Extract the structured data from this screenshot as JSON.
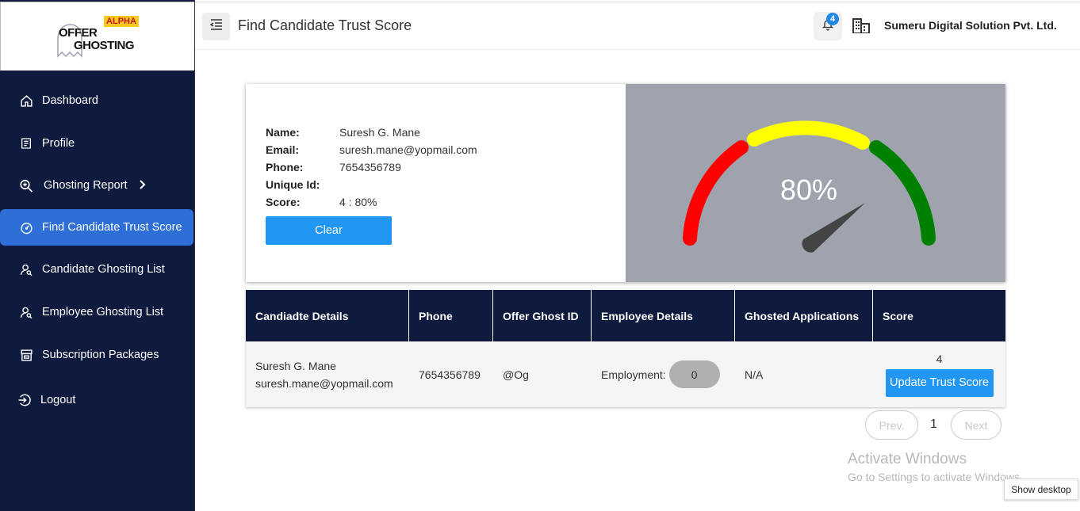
{
  "logo": {
    "badge": "ALPHA",
    "line1": "OFFER",
    "line2": "GHOSTING"
  },
  "sidebar": {
    "items": [
      {
        "label": "Dashboard",
        "icon": "home-icon"
      },
      {
        "label": "Profile",
        "icon": "profile-icon"
      },
      {
        "label": "Ghosting Report",
        "icon": "search-zoom-icon"
      },
      {
        "label": "Find Candidate Trust Score",
        "icon": "speedometer-icon",
        "active": true
      },
      {
        "label": "Candidate Ghosting List",
        "icon": "user-search-icon"
      },
      {
        "label": "Employee Ghosting List",
        "icon": "user-search-icon"
      },
      {
        "label": "Subscription Packages",
        "icon": "store-icon"
      },
      {
        "label": "Logout",
        "icon": "logout-icon"
      }
    ]
  },
  "header": {
    "title": "Find Candidate Trust Score",
    "notification_count": "4",
    "org_name": "Sumeru Digital Solution Pvt. Ltd."
  },
  "candidate": {
    "labels": {
      "name": "Name:",
      "email": "Email:",
      "phone": "Phone:",
      "unique_id": "Unique Id:",
      "score": "Score:"
    },
    "name": "Suresh G. Mane",
    "email": "suresh.mane@yopmail.com",
    "phone": "7654356789",
    "unique_id": "",
    "score": "4 : 80%",
    "clear_label": "Clear"
  },
  "gauge": {
    "value_text": "80%",
    "value_fraction": 0.8,
    "colors": {
      "red": "#ff0000",
      "yellow": "#ffff00",
      "green": "#008000",
      "needle": "#444444",
      "panel": "#9ea3ad"
    }
  },
  "table": {
    "headers": [
      "Candiadte Details",
      "Phone",
      "Offer Ghost ID",
      "Employee Details",
      "Ghosted Applications",
      "Score"
    ],
    "row": {
      "cand_name": "Suresh G. Mane",
      "cand_email": "suresh.mane@yopmail.com",
      "phone": "7654356789",
      "ghost_id": "@Og",
      "employment_label": "Employment:",
      "employment_count": "0",
      "ghosted_apps": "N/A",
      "score": "4",
      "update_label": "Update Trust Score"
    }
  },
  "pagination": {
    "prev": "Prev.",
    "page": "1",
    "next": "Next"
  },
  "watermark": {
    "line1": "Activate Windows",
    "line2": "Go to Settings to activate Windows."
  },
  "taskbar": {
    "show_desktop": "Show desktop"
  }
}
